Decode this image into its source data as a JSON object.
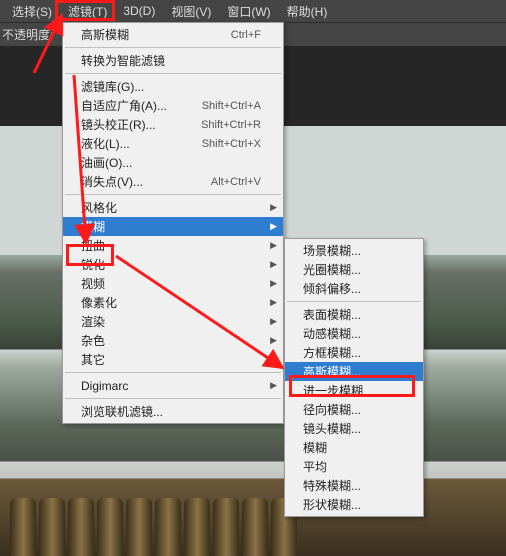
{
  "menubar": {
    "items": [
      {
        "label": "选择(S)"
      },
      {
        "label": "滤镜(T)"
      },
      {
        "label": "3D(D)"
      },
      {
        "label": "视图(V)"
      },
      {
        "label": "窗口(W)"
      },
      {
        "label": "帮助(H)"
      }
    ]
  },
  "toolbar": {
    "opacity_label": "不透明度:"
  },
  "filter_menu": {
    "items": [
      {
        "label": "高斯模糊",
        "shortcut": "Ctrl+F",
        "sub": false
      },
      {
        "sep": true
      },
      {
        "label": "转换为智能滤镜",
        "sub": false
      },
      {
        "sep": true
      },
      {
        "label": "滤镜库(G)...",
        "sub": false
      },
      {
        "label": "自适应广角(A)...",
        "shortcut": "Shift+Ctrl+A",
        "sub": false
      },
      {
        "label": "镜头校正(R)...",
        "shortcut": "Shift+Ctrl+R",
        "sub": false
      },
      {
        "label": "液化(L)...",
        "shortcut": "Shift+Ctrl+X",
        "sub": false
      },
      {
        "label": "油画(O)...",
        "sub": false
      },
      {
        "label": "消失点(V)...",
        "shortcut": "Alt+Ctrl+V",
        "sub": false
      },
      {
        "sep": true
      },
      {
        "label": "风格化",
        "sub": true
      },
      {
        "label": "模糊",
        "sub": true,
        "selected": true
      },
      {
        "label": "扭曲",
        "sub": true
      },
      {
        "label": "锐化",
        "sub": true
      },
      {
        "label": "视频",
        "sub": true
      },
      {
        "label": "像素化",
        "sub": true
      },
      {
        "label": "渲染",
        "sub": true
      },
      {
        "label": "杂色",
        "sub": true
      },
      {
        "label": "其它",
        "sub": true
      },
      {
        "sep": true
      },
      {
        "label": "Digimarc",
        "sub": true
      },
      {
        "sep": true
      },
      {
        "label": "浏览联机滤镜...",
        "sub": false
      }
    ]
  },
  "blur_submenu": {
    "items": [
      {
        "label": "场景模糊..."
      },
      {
        "label": "光圈模糊..."
      },
      {
        "label": "倾斜偏移..."
      },
      {
        "sep": true
      },
      {
        "label": "表面模糊..."
      },
      {
        "label": "动感模糊..."
      },
      {
        "label": "方框模糊..."
      },
      {
        "label": "高斯模糊...",
        "selected": true
      },
      {
        "label": "进一步模糊"
      },
      {
        "label": "径向模糊..."
      },
      {
        "label": "镜头模糊..."
      },
      {
        "label": "模糊"
      },
      {
        "label": "平均"
      },
      {
        "label": "特殊模糊..."
      },
      {
        "label": "形状模糊..."
      }
    ]
  },
  "annotation_color": "#ff1a1a"
}
